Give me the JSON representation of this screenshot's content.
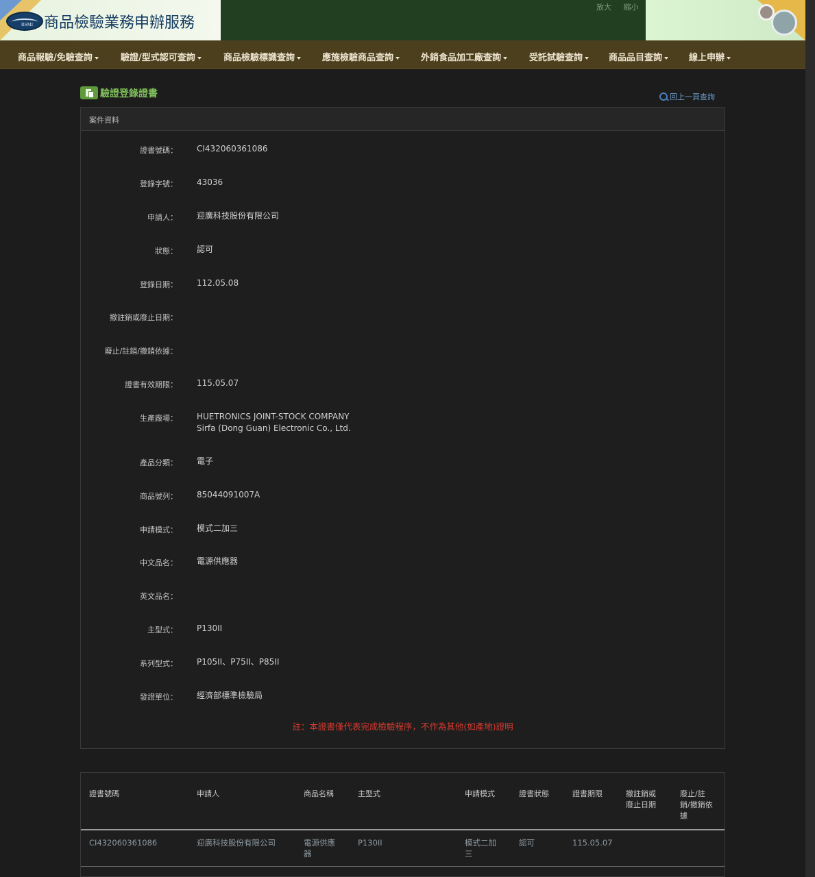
{
  "header": {
    "site_title": "商品檢驗業務申辦服務",
    "zoom_in": "放大",
    "zoom_out": "縮小",
    "colors": {
      "nav_bg": "#4c3f1d",
      "header_bg": "#233f22",
      "accent_green": "#7fbd5a",
      "note_red": "#d93a2e"
    }
  },
  "nav": {
    "items": [
      "商品報驗/免驗查詢",
      "驗證/型式認可查詢",
      "商品檢驗標識查詢",
      "應施檢驗商品查詢",
      "外銷食品加工廠查詢",
      "受託試驗查詢",
      "商品品目查詢",
      "線上申辦"
    ]
  },
  "page": {
    "title": "驗證登錄證書",
    "back_link": "回上一頁查詢",
    "panel_title": "案件資料"
  },
  "fields": [
    {
      "label": "證書號碼：",
      "value": "CI432060361086"
    },
    {
      "label": "登錄字號：",
      "value": "43036"
    },
    {
      "label": "申請人：",
      "value": "迎廣科技股份有限公司"
    },
    {
      "label": "狀態：",
      "value": "認可"
    },
    {
      "label": "登錄日期：",
      "value": "112.05.08"
    },
    {
      "label": "撤註銷或廢止日期：",
      "value": ""
    },
    {
      "label": "廢止/註銷/撤銷依據：",
      "value": ""
    },
    {
      "label": "證書有效期限：",
      "value": "115.05.07"
    },
    {
      "label": "生產廠場：",
      "value": "HUETRONICS JOINT-STOCK COMPANY",
      "value2": "Sirfa (Dong Guan) Electronic Co., Ltd."
    },
    {
      "label": "產品分類：",
      "value": "電子"
    },
    {
      "label": "商品號列：",
      "value": "85044091007A"
    },
    {
      "label": "申請模式：",
      "value": "模式二加三"
    },
    {
      "label": "中文品名：",
      "value": "電源供應器"
    },
    {
      "label": "英文品名：",
      "value": ""
    },
    {
      "label": "主型式：",
      "value": "P130II"
    },
    {
      "label": "系列型式：",
      "value": "P105II、P75II、P85II"
    },
    {
      "label": "發證單位：",
      "value": "經濟部標準檢驗局"
    }
  ],
  "note": "註：本證書僅代表完成檢驗程序，不作為其他(如產地)證明",
  "table": {
    "headers": [
      [
        "證書號碼"
      ],
      [
        "申請人"
      ],
      [
        "商品名稱"
      ],
      [
        "主型式"
      ],
      [
        "申請模式"
      ],
      [
        "證書狀態"
      ],
      [
        "證書期限"
      ],
      [
        "撤註銷或",
        "廢止日期"
      ],
      [
        "廢止/註",
        "銷/撤銷依",
        "據"
      ]
    ],
    "row": [
      [
        "CI432060361086"
      ],
      [
        "迎廣科技股份有限公司"
      ],
      [
        "電源供應",
        "器"
      ],
      [
        "P130II"
      ],
      [
        "模式二加",
        "三"
      ],
      [
        "認可"
      ],
      [
        "115.05.07"
      ],
      [
        ""
      ],
      [
        ""
      ]
    ]
  }
}
